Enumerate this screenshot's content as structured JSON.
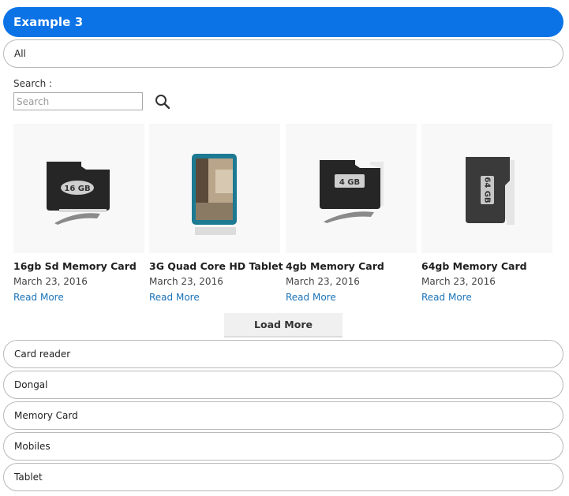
{
  "header": {
    "title": "Example 3"
  },
  "filters": {
    "all_label": "All",
    "categories": [
      "Card reader",
      "Dongal",
      "Memory Card",
      "Mobiles",
      "Tablet"
    ]
  },
  "search": {
    "label": "Search :",
    "placeholder": "Search",
    "icon": "search-icon"
  },
  "products": [
    {
      "title": "16gb Sd Memory Card",
      "date": "March 23, 2016",
      "link": "Read More",
      "image_text": "16 GB"
    },
    {
      "title": "3G Quad Core HD Tablet",
      "date": "March 23, 2016",
      "link": "Read More"
    },
    {
      "title": "4gb Memory Card",
      "date": "March 23, 2016",
      "link": "Read More",
      "image_text": "4 GB"
    },
    {
      "title": "64gb Memory Card",
      "date": "March 23, 2016",
      "link": "Read More",
      "image_text": "64 GB"
    }
  ],
  "load_more": {
    "label": "Load More"
  },
  "colors": {
    "accent": "#0b73e6",
    "link": "#1a73b8"
  }
}
